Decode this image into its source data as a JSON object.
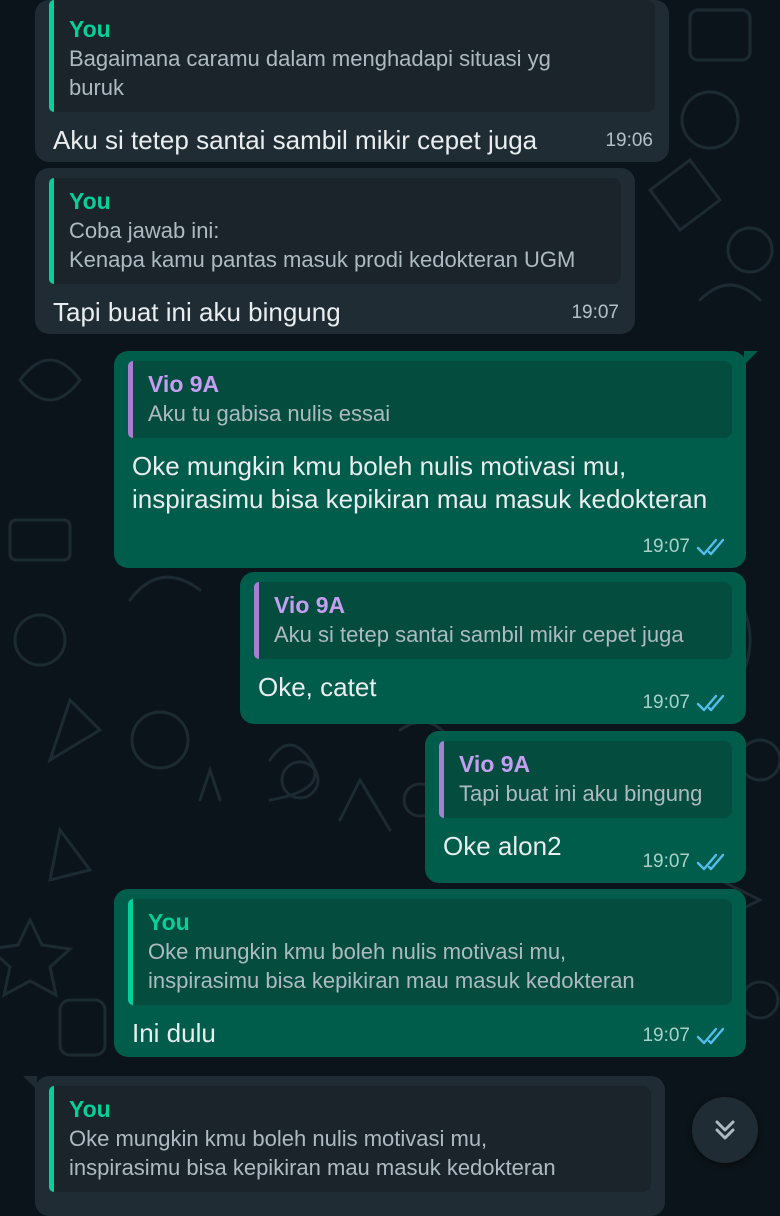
{
  "messages": [
    {
      "sender_quoted": "You",
      "quoted": "Bagaimana caramu dalam menghadapi situasi yg\nburuk",
      "text": "Aku si tetep santai sambil mikir cepet juga",
      "time": "19:06"
    },
    {
      "sender_quoted": "You",
      "quoted": "Coba jawab ini:\nKenapa kamu pantas masuk prodi kedokteran UGM",
      "text": "Tapi buat ini aku bingung",
      "time": "19:07"
    },
    {
      "sender_quoted": "Vio 9A",
      "quoted": "Aku tu gabisa nulis essai",
      "text": "Oke mungkin kmu boleh nulis motivasi mu,\ninspirasimu bisa kepikiran mau masuk kedokteran",
      "time": "19:07"
    },
    {
      "sender_quoted": "Vio 9A",
      "quoted": "Aku si tetep santai sambil mikir cepet juga",
      "text": "Oke, catet",
      "time": "19:07"
    },
    {
      "sender_quoted": "Vio 9A",
      "quoted": "Tapi buat ini aku bingung",
      "text": "Oke alon2",
      "time": "19:07"
    },
    {
      "sender_quoted": "You",
      "quoted": "Oke mungkin kmu boleh nulis motivasi mu,\ninspirasimu bisa kepikiran mau masuk kedokteran",
      "text": "Ini dulu",
      "time": "19:07"
    },
    {
      "sender_quoted": "You",
      "quoted": "Oke mungkin kmu boleh nulis motivasi mu,\ninspirasimu bisa kepikiran mau masuk kedokteran"
    }
  ],
  "icons": {
    "read_receipt": "double-check-icon",
    "scroll_down": "chevrons-down-icon"
  },
  "colors": {
    "background": "#0b141a",
    "incoming": "#202c33",
    "outgoing": "#005c4b",
    "you_accent": "#06cf9c",
    "contact_accent": "#c59ef2",
    "read_ticks": "#53bdeb"
  }
}
